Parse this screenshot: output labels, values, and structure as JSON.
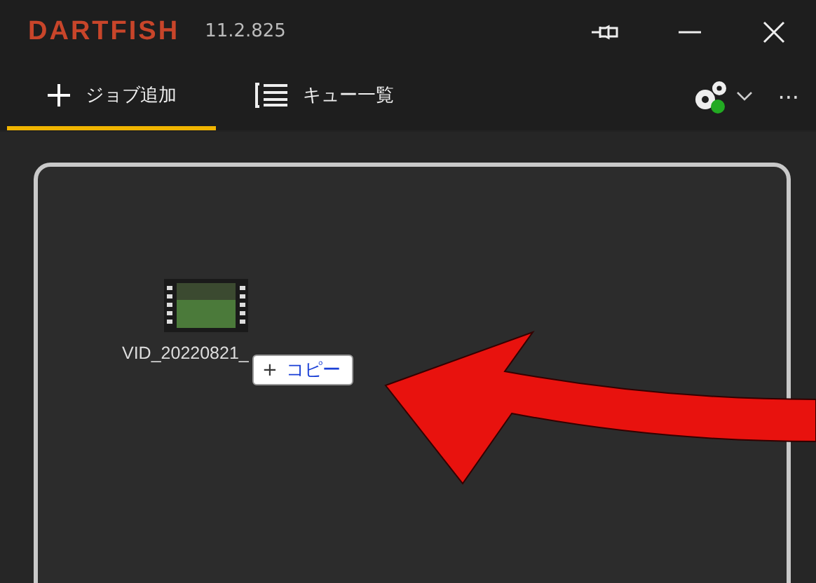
{
  "window": {
    "app_name": "DARTFISH",
    "version": "11.2.825"
  },
  "tabs": [
    {
      "label": "ジョブ追加",
      "kind": "add",
      "selected": true
    },
    {
      "label": "キュー一覧",
      "kind": "list",
      "selected": false
    }
  ],
  "more_button": {
    "label": "···"
  },
  "drop_area": {
    "file": {
      "name": "VID_20220821_"
    },
    "drag_badge": {
      "icon": "+",
      "label": "コピー"
    }
  }
}
